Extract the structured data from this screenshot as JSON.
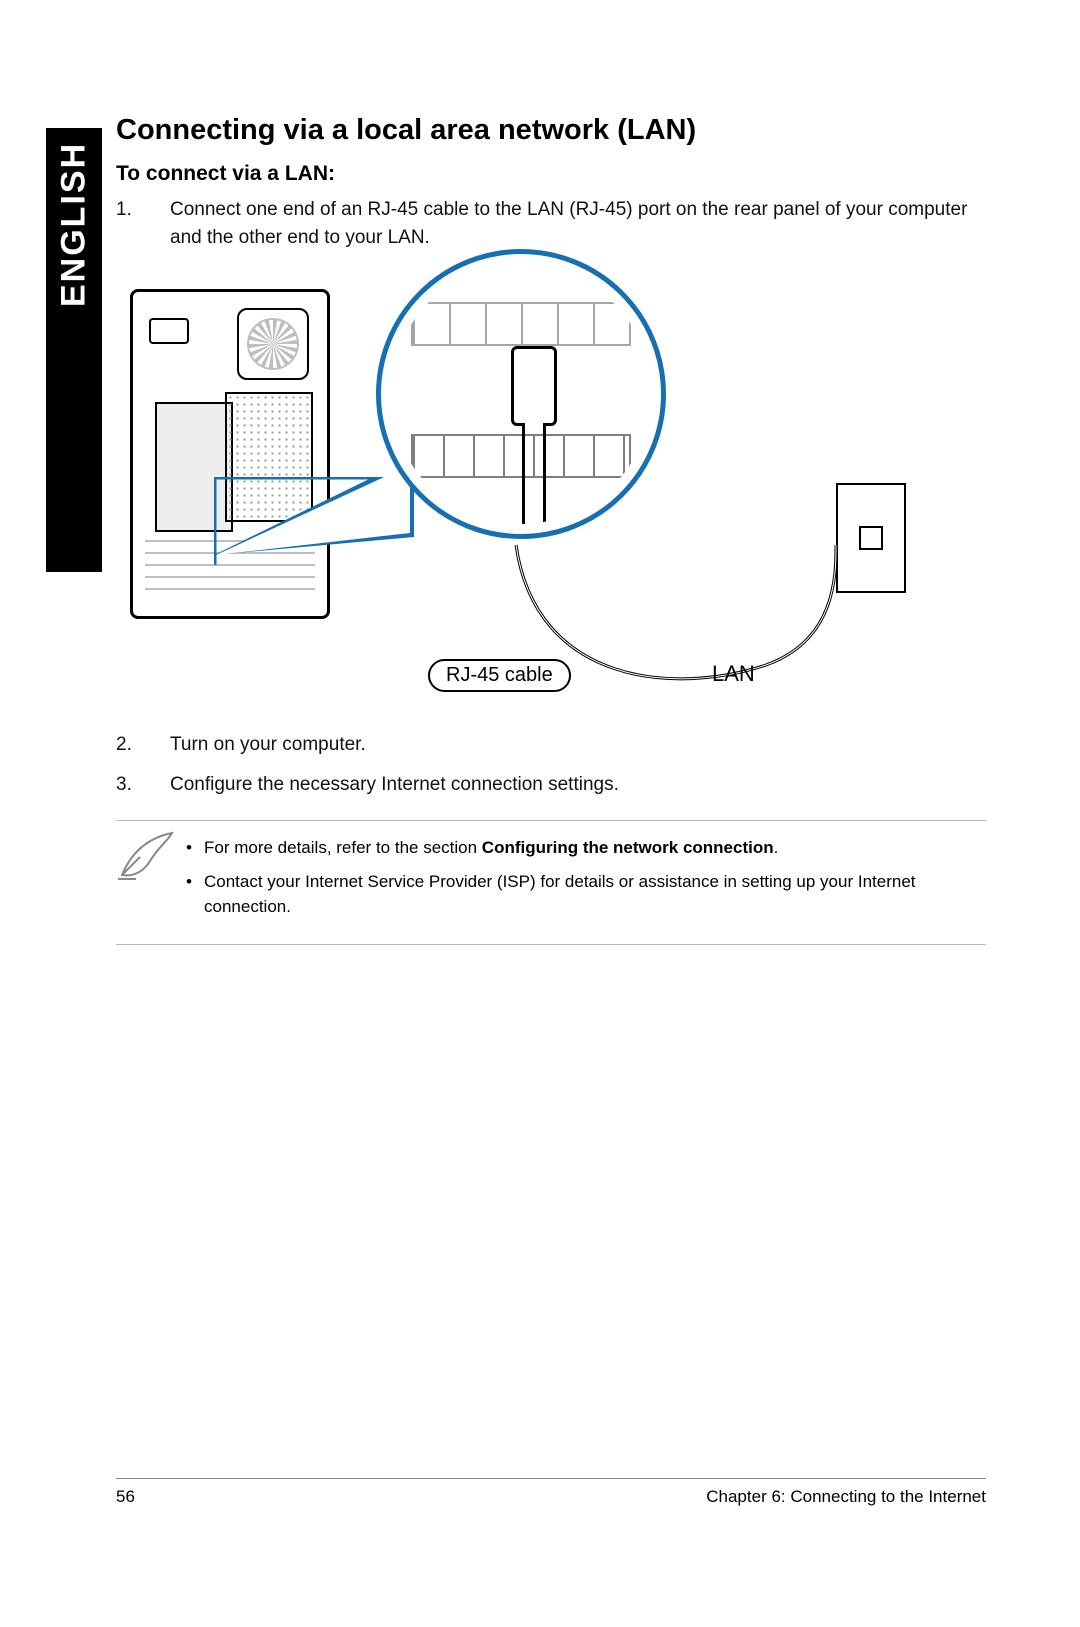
{
  "sideTab": "ENGLISH",
  "heading": "Connecting via a local area network (LAN)",
  "subheading": "To connect via a LAN:",
  "steps": {
    "s1": "Connect one end of an RJ-45 cable to the LAN (RJ-45) port on the rear panel of your computer and the other end to your LAN.",
    "s2": "Turn on your computer.",
    "s3": "Configure the necessary Internet connection settings."
  },
  "diagram": {
    "cableLabel": "RJ-45 cable",
    "lanLabel": "LAN"
  },
  "notes": {
    "n1_prefix": "For more details, refer to the section ",
    "n1_bold": "Configuring the network connection",
    "n1_suffix": ".",
    "n2": "Contact your Internet Service Provider (ISP) for details or assistance in setting up your Internet connection."
  },
  "footer": {
    "pageNumber": "56",
    "chapter": "Chapter 6: Connecting to the Internet"
  }
}
